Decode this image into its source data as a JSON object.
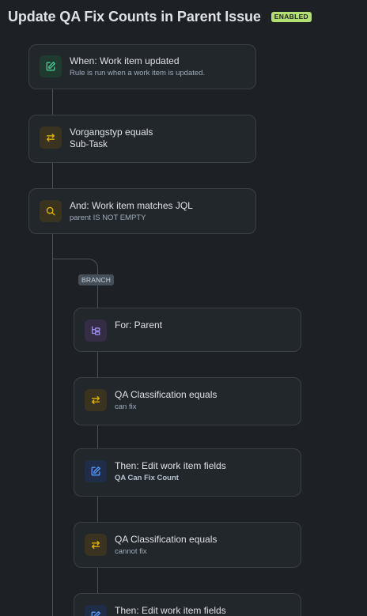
{
  "header": {
    "title": "Update QA Fix Counts in Parent Issue",
    "status_badge": "ENABLED"
  },
  "branch_label": "BRANCH",
  "nodes": [
    {
      "title": "When: Work item updated",
      "subtitle": "Rule is run when a work item is updated.",
      "icon": "edit-square-icon",
      "color": "#4bce97"
    },
    {
      "title": "Vorgangstyp equals",
      "subtitle": "Sub-Task",
      "icon": "swap-arrows-icon",
      "color": "#e2b203"
    },
    {
      "title": "And: Work item matches JQL",
      "subtitle": "parent IS NOT EMPTY",
      "icon": "search-icon",
      "color": "#e2b203"
    },
    {
      "title": "For: Parent",
      "subtitle": "",
      "icon": "hierarchy-icon",
      "color": "#9f8fef"
    },
    {
      "title": "QA Classification equals",
      "subtitle": "can fix",
      "icon": "swap-arrows-icon",
      "color": "#e2b203"
    },
    {
      "title": "Then: Edit work item fields",
      "subtitle": "QA Can Fix Count",
      "icon": "edit-square-icon",
      "color": "#579dff"
    },
    {
      "title": "QA Classification equals",
      "subtitle": "cannot fix",
      "icon": "swap-arrows-icon",
      "color": "#e2b203"
    },
    {
      "title": "Then: Edit work item fields",
      "subtitle": "",
      "icon": "edit-square-icon",
      "color": "#579dff"
    }
  ]
}
